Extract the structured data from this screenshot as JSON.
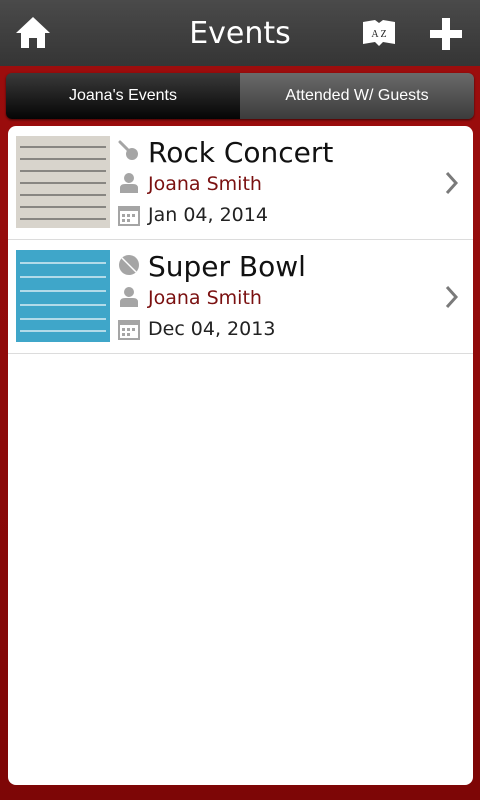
{
  "header": {
    "title": "Events",
    "home_icon": "home-icon",
    "sort_icon": "sort-az-icon",
    "sort_glyph": "A Z",
    "add_icon": "plus-icon"
  },
  "tabs": [
    {
      "label": "Joana's Events",
      "active": true
    },
    {
      "label": "Attended W/ Guests",
      "active": false
    }
  ],
  "events": [
    {
      "name": "Rock Concert",
      "category_icon": "guitar-icon",
      "host": "Joana Smith",
      "date": "Jan 04, 2014",
      "thumbnail": "concert-ticket-image"
    },
    {
      "name": "Super Bowl",
      "category_icon": "ball-icon",
      "host": "Joana Smith",
      "date": "Dec 04, 2013",
      "thumbnail": "game-ticket-image"
    }
  ],
  "colors": {
    "header_bg": "#3c3c3c",
    "frame_red": "#8c0a0a",
    "host_text": "#7a1010"
  }
}
